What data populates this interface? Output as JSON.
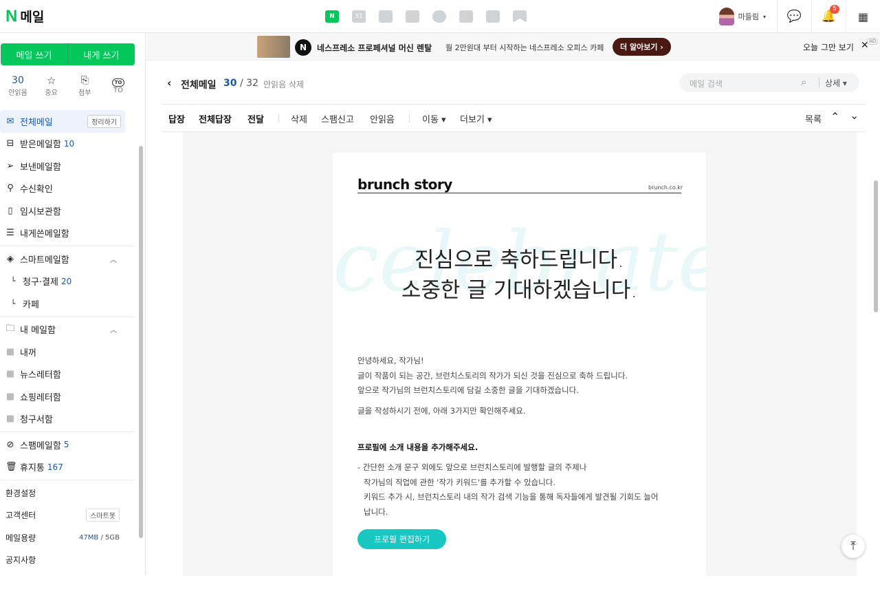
{
  "header": {
    "logo_mark": "N",
    "logo_text": "메일",
    "apps": [
      "mail-app-icon",
      "calendar-app-icon",
      "memo-app-icon",
      "contacts-app-icon",
      "mybox-app-icon",
      "todo-app-icon",
      "pay-app-icon",
      "bookmark-app-icon"
    ],
    "calendar_num": "31",
    "user_name": "마들림",
    "notification_count": "5"
  },
  "sidebar": {
    "write_label": "메일 쓰기",
    "self_write_label": "내게 쓰기",
    "quick": [
      {
        "value": "30",
        "label": "안읽음"
      },
      {
        "icon": "☆",
        "label": "중요"
      },
      {
        "icon": "📎",
        "label": "첨부"
      },
      {
        "icon": "TO",
        "label": "TO"
      }
    ],
    "items": [
      {
        "label": "전체메일",
        "tag": "정리하기",
        "icon": "envelope-icon"
      },
      {
        "label": "받은메일함",
        "count": "10",
        "icon": "inbox-icon"
      },
      {
        "label": "보낸메일함",
        "icon": "send-icon"
      },
      {
        "label": "수신확인",
        "icon": "receipt-icon"
      },
      {
        "label": "임시보관함",
        "icon": "draft-icon"
      },
      {
        "label": "내게쓴메일함",
        "icon": "note-icon"
      },
      {
        "label": "스마트메일함",
        "icon": "layers-icon"
      },
      {
        "label": "청구·결제",
        "count": "20"
      },
      {
        "label": "카페"
      },
      {
        "label": "내 메일함",
        "icon": "folder-icon"
      },
      {
        "label": "내꺼"
      },
      {
        "label": "뉴스레터함"
      },
      {
        "label": "쇼핑레터함"
      },
      {
        "label": "청구서함"
      },
      {
        "label": "스팸메일함",
        "count": "5",
        "icon": "spam-icon"
      },
      {
        "label": "휴지통",
        "count": "167",
        "icon": "trash-icon"
      }
    ],
    "settings": "환경설정",
    "support": "고객센터",
    "smartbot": "스마트봇",
    "storage_label": "메일용량",
    "storage_used": "47MB",
    "storage_sep": "/",
    "storage_total": "5GB",
    "notice": "공지사항"
  },
  "ad": {
    "brand": "네스프레소 프로페셔널 머신 렌탈",
    "desc": "월 2만원대 부터 시작하는 네스프레소 오피스 카페",
    "cta": "더 알아보기 ›",
    "dismiss": "오늘 그만 보기",
    "close": "✕",
    "ad_label": "AD"
  },
  "mailhead": {
    "title": "전체메일",
    "count": "30",
    "slash": "/",
    "total": "32",
    "delete_unread": "안읽음 삭제",
    "search_placeholder": "메일 검색",
    "detail": "상세 ▾"
  },
  "toolbar": {
    "reply": "답장",
    "reply_all": "전체답장",
    "forward": "전달",
    "delete": "삭제",
    "spam": "스팸신고",
    "unread": "안읽음",
    "move": "이동 ▾",
    "more": "더보기 ▾",
    "list": "목록",
    "up": "⌃",
    "down": "⌄"
  },
  "email": {
    "brand_logo": "brunch story",
    "brand_url": "brunch.co.kr",
    "watermark": "celebrate",
    "headline1": "진심으로 축하드립니다.",
    "headline2": "소중한 글 기대하겠습니다.",
    "p1": "안녕하세요, 작가님!",
    "p2": "글이 작품이 되는 공간, 브런치스토리의 작가가 되신 것을 진심으로 축하 드립니다.",
    "p3": "앞으로 작가님의 브런치스토리에 담길 소중한 글을 기대하겠습니다.",
    "p4": "글을 작성하시기 전에, 아래 3가지만 확인해주세요.",
    "section_title": "프로필에 소개 내용을 추가해주세요.",
    "l1": "- 간단한 소개 문구 외에도 앞으로 브런치스토리에 발행할 글의 주제나",
    "l2": "작가님의 직업에 관한 '작가 키워드'를 추가할 수 있습니다.",
    "l3": "키워드 추가 시, 브런치스토리 내의 작가 검색 기능을 통해 독자들에게 발견될 기회도 늘어",
    "l4": "납니다.",
    "button": "프로필 편집하기"
  },
  "colors": {
    "accent": "#03c75a",
    "link": "#1b57a7",
    "button": "#19c7c2"
  }
}
